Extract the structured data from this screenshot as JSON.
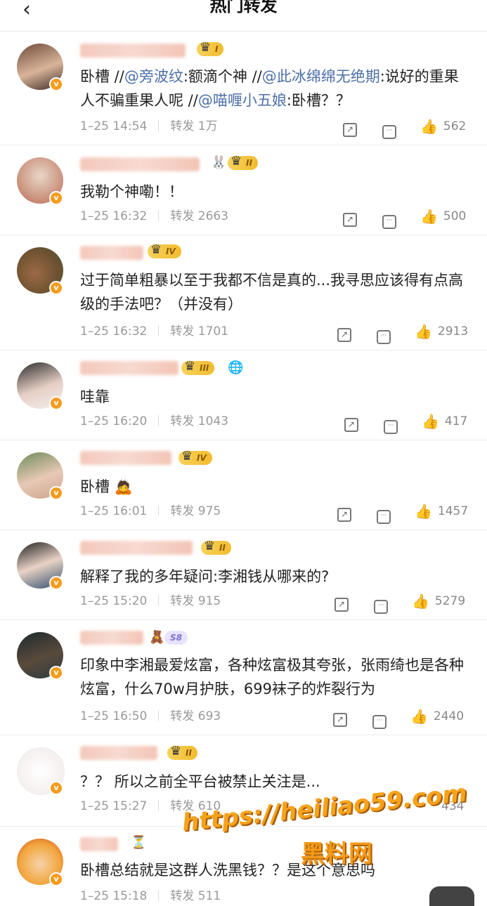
{
  "header": {
    "back_icon": "‹",
    "title": "热门转发"
  },
  "posts": [
    {
      "level": "I",
      "text_parts": [
        {
          "t": "卧槽 //",
          "m": false
        },
        {
          "t": "@旁波纹",
          "m": true
        },
        {
          "t": ":额滴个神 //",
          "m": false
        },
        {
          "t": "@此冰绵绵无绝期",
          "m": true
        },
        {
          "t": ":说好的重果人不骗重果人呢 //",
          "m": false
        },
        {
          "t": "@喵喱小五娘",
          "m": true
        },
        {
          "t": ":卧槽？？",
          "m": false
        }
      ],
      "time": "1–25 14:54",
      "repost": "转发 1万",
      "likes": "562"
    },
    {
      "level": "II",
      "text": "我勒个神嘞！！",
      "time": "1–25 16:32",
      "repost": "转发 2663",
      "likes": "500"
    },
    {
      "level": "IV",
      "text": "过于简单粗暴以至于我都不信是真的...我寻思应该得有点高级的手法吧？（并没有）",
      "time": "1–25 16:32",
      "repost": "转发 1701",
      "likes": "2913"
    },
    {
      "level": "III",
      "text": "哇靠",
      "time": "1–25 16:20",
      "repost": "转发 1043",
      "likes": "417"
    },
    {
      "level": "IV",
      "text": "卧槽 🙇",
      "time": "1–25 16:01",
      "repost": "转发 975",
      "likes": "1457"
    },
    {
      "level": "II",
      "text": "解释了我的多年疑问:李湘钱从哪来的?",
      "time": "1–25 15:20",
      "repost": "转发 915",
      "likes": "5279"
    },
    {
      "level": "S8",
      "text": "印象中李湘最爱炫富，各种炫富极其夸张，张雨绮也是各种炫富，什么70w月护肤，699袜子的炸裂行为",
      "time": "1–25 16:50",
      "repost": "转发 693",
      "likes": "2440"
    },
    {
      "level": "II",
      "text": "？？ 所以之前全平台被禁止关注是...",
      "time": "1–25 15:27",
      "repost": "转发 610",
      "likes": "434"
    },
    {
      "level": "",
      "text": "卧槽总结就是这群人洗黑钱？？是这个意思吗",
      "time": "1–25 15:18",
      "repost": "转发 511",
      "likes": ""
    }
  ],
  "watermark": {
    "line1": "https://heiliao59.com",
    "line2": "黑料网"
  },
  "colors": {
    "accent_orange": "#f79b1c",
    "mention_blue": "#4c6fa8",
    "meta_gray": "#999999"
  }
}
